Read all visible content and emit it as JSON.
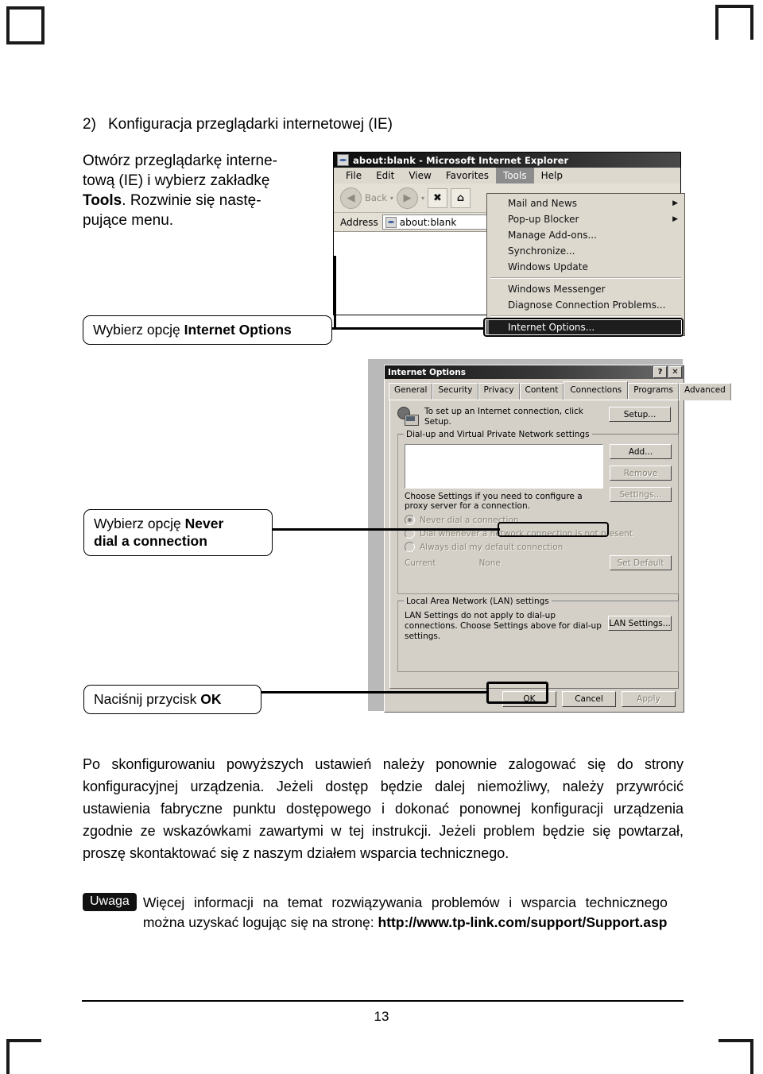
{
  "page": {
    "number": "13"
  },
  "section": {
    "number": "2)",
    "title": "Konfiguracja przeglądarki internetowej (IE)"
  },
  "intro": {
    "line1": "Otwórz przeglądarkę interne-",
    "line2": "tową (IE) i wybierz zakładkę",
    "bold1": "Tools",
    "line3": ". Rozwinie się nastę-",
    "line4": "pujące menu."
  },
  "callouts": {
    "internet_options": {
      "prefix": "Wybierz opcję ",
      "bold": "Internet Options"
    },
    "never_dial": {
      "prefix": "Wybierz opcję ",
      "bold1": "Never",
      "bold2": "dial a connection"
    },
    "ok": {
      "prefix": "Naciśnij przycisk ",
      "bold": "OK"
    }
  },
  "ie_window": {
    "title": "about:blank - Microsoft Internet Explorer",
    "menu": [
      "File",
      "Edit",
      "View",
      "Favorites",
      "Tools",
      "Help"
    ],
    "selected_menu": "Tools",
    "toolbar": {
      "back_label": "Back",
      "caret": "▾",
      "stop_glyph": "✖",
      "home_glyph": "⌂"
    },
    "address_label": "Address",
    "address_value": "about:blank"
  },
  "tools_menu": {
    "items": [
      {
        "label": "Mail and News",
        "submenu": true
      },
      {
        "label": "Pop-up Blocker",
        "submenu": true
      },
      {
        "label": "Manage Add-ons...",
        "submenu": false
      },
      {
        "label": "Synchronize...",
        "submenu": false
      },
      {
        "label": "Windows Update",
        "submenu": false
      }
    ],
    "items2": [
      {
        "label": "Windows Messenger",
        "submenu": false
      },
      {
        "label": "Diagnose Connection Problems...",
        "submenu": false
      }
    ],
    "highlighted": "Internet Options..."
  },
  "internet_options": {
    "title": "Internet Options",
    "help_btn": "?",
    "close_btn": "✕",
    "tabs": [
      "General",
      "Security",
      "Privacy",
      "Content",
      "Connections",
      "Programs",
      "Advanced"
    ],
    "active_tab": "Connections",
    "setup_text": "To set up an Internet connection, click Setup.",
    "setup_button": "Setup...",
    "dialup_group": "Dial-up and Virtual Private Network settings",
    "add_button": "Add...",
    "remove_button": "Remove",
    "settings_button": "Settings...",
    "proxy_text": "Choose Settings if you need to configure a proxy server for a connection.",
    "radios": [
      {
        "label": "Never dial a connection",
        "checked": true
      },
      {
        "label": "Dial whenever a network connection is not present",
        "checked": false
      },
      {
        "label": "Always dial my default connection",
        "checked": false
      }
    ],
    "current_label": "Current",
    "current_value": "None",
    "set_default_button": "Set Default",
    "lan_group": "Local Area Network (LAN) settings",
    "lan_text": "LAN Settings do not apply to dial-up connections. Choose Settings above for dial-up settings.",
    "lan_button": "LAN Settings...",
    "ok_button": "OK",
    "cancel_button": "Cancel",
    "apply_button": "Apply"
  },
  "paragraph": "Po skonfigurowaniu powyższych ustawień należy ponownie zalogować się do strony konfiguracyjnej urządzenia. Jeżeli dostęp będzie dalej niemożliwy, należy przywrócić ustawienia fabryczne punktu dostępowego i dokonać ponownej konfiguracji urządzenia zgodnie ze wskazówkami zawartymi w tej instrukcji. Jeżeli problem będzie się powtarzał, proszę skontaktować się z naszym działem wsparcia technicznego.",
  "note": {
    "badge": "Uwaga",
    "text": "Więcej informacji na temat rozwiązywania problemów i wsparcia technicznego można uzyskać logując się na stronę: ",
    "url": "http://www.tp-link.com/support/Support.asp"
  }
}
